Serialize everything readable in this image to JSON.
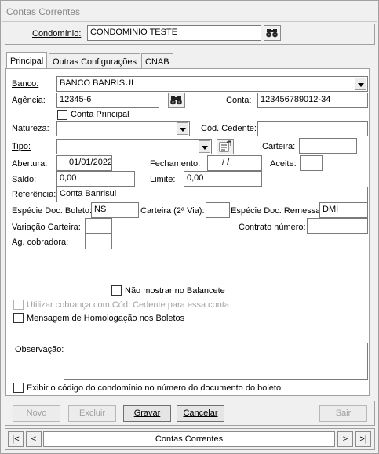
{
  "window": {
    "title": "Contas Correntes"
  },
  "header": {
    "condominio_label": "Condomínio:",
    "condominio_value": "CONDOMINIO TESTE"
  },
  "tabs": [
    {
      "label": "Principal"
    },
    {
      "label": "Outras Configurações"
    },
    {
      "label": "CNAB"
    }
  ],
  "form": {
    "banco_label": "Banco:",
    "banco_value": "BANCO BANRISUL",
    "agencia_label": "Agência:",
    "agencia_value": "12345-6",
    "conta_label": "Conta:",
    "conta_value": "123456789012-34",
    "conta_principal_label": "Conta Principal",
    "natureza_label": "Natureza:",
    "natureza_value": "",
    "cod_cedente_label": "Cód. Cedente:",
    "cod_cedente_value": "",
    "tipo_label": "Tipo:",
    "tipo_value": "",
    "carteira_label": "Carteira:",
    "carteira_value": "",
    "abertura_label": "Abertura:",
    "abertura_value": "01/01/2022",
    "fechamento_label": "Fechamento:",
    "fechamento_value": " / /",
    "aceite_label": "Aceite:",
    "aceite_value": "",
    "saldo_label": "Saldo:",
    "saldo_value": "0,00",
    "limite_label": "Limite:",
    "limite_value": "0,00",
    "referencia_label": "Referência:",
    "referencia_value": "Conta Banrisul",
    "especie_boleto_label": "Espécie Doc. Boleto:",
    "especie_boleto_value": "NS",
    "carteira2_label": "Carteira (2ª Via):",
    "carteira2_value": "",
    "especie_remessa_label": "Espécie Doc. Remessa:",
    "especie_remessa_value": "DMI",
    "variacao_label": "Variação Carteira:",
    "variacao_value": "",
    "contrato_label": "Contrato número:",
    "contrato_value": "",
    "ag_cobradora_label": "Ag. cobradora:",
    "ag_cobradora_value": "",
    "nao_mostrar_label": "Não mostrar no Balancete",
    "utilizar_cobranca_label": "Utilizar cobrança com Cód. Cedente para essa conta",
    "mensagem_label": "Mensagem de Homologação nos Boletos",
    "observacao_label": "Observação:",
    "exibir_codigo_label": "Exibir o código do condomínio no número do documento do boleto"
  },
  "toolbar": {
    "novo": "Novo",
    "excluir": "Excluir",
    "gravar": "Gravar",
    "cancelar": "Cancelar",
    "sair": "Sair"
  },
  "navigator": {
    "first": "|<",
    "prev": "<",
    "caption": "Contas Correntes",
    "next": ">",
    "last": ">|"
  },
  "icons": [
    "binoculars-icon",
    "binoculars-icon",
    "lookup-icon",
    "dropdown-arrow-icon"
  ]
}
